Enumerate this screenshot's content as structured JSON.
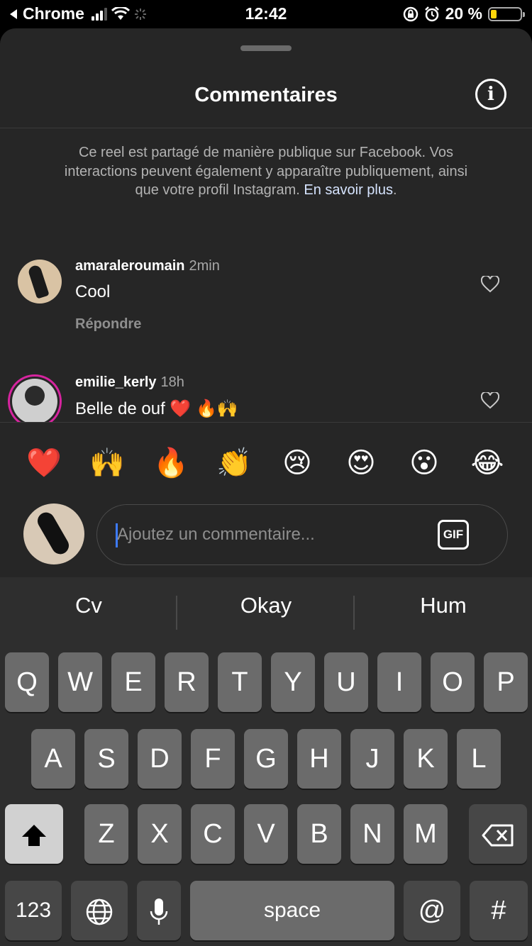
{
  "status_bar": {
    "back_app": "Chrome",
    "time": "12:42",
    "battery_percent": "20 %",
    "battery_level": 0.2
  },
  "sheet": {
    "title": "Commentaires",
    "notice_text": "Ce reel est partagé de manière publique sur Facebook. Vos interactions peuvent également y apparaître publiquement, ainsi que votre profil Instagram.",
    "notice_link": "En savoir plus",
    "notice_end": "."
  },
  "comments": [
    {
      "username": "amaraleroumain",
      "time": "2min",
      "text": "Cool",
      "reply_label": "Répondre"
    },
    {
      "username": "emilie_kerly",
      "time": "18h",
      "text": "Belle de ouf ❤️ 🔥🙌"
    }
  ],
  "emoji_reactions": [
    "❤️",
    "🙌",
    "🔥",
    "👏",
    "😢",
    "😍",
    "😮",
    "😂"
  ],
  "composer": {
    "placeholder": "Ajoutez un commentaire...",
    "gif_label": "GIF"
  },
  "keyboard": {
    "suggestions": [
      "Cv",
      "Okay",
      "Hum"
    ],
    "row1": [
      "Q",
      "W",
      "E",
      "R",
      "T",
      "Y",
      "U",
      "I",
      "O",
      "P"
    ],
    "row2": [
      "A",
      "S",
      "D",
      "F",
      "G",
      "H",
      "J",
      "K",
      "L"
    ],
    "row3": [
      "Z",
      "X",
      "C",
      "V",
      "B",
      "N",
      "M"
    ],
    "numbers_key": "123",
    "space_key": "space",
    "at_key": "@",
    "hash_key": "#"
  },
  "icons": {
    "shift": "shift-icon",
    "backspace": "backspace-icon",
    "globe": "globe-icon",
    "mic": "microphone-icon",
    "info": "info-icon",
    "heart": "heart-outline-icon"
  }
}
